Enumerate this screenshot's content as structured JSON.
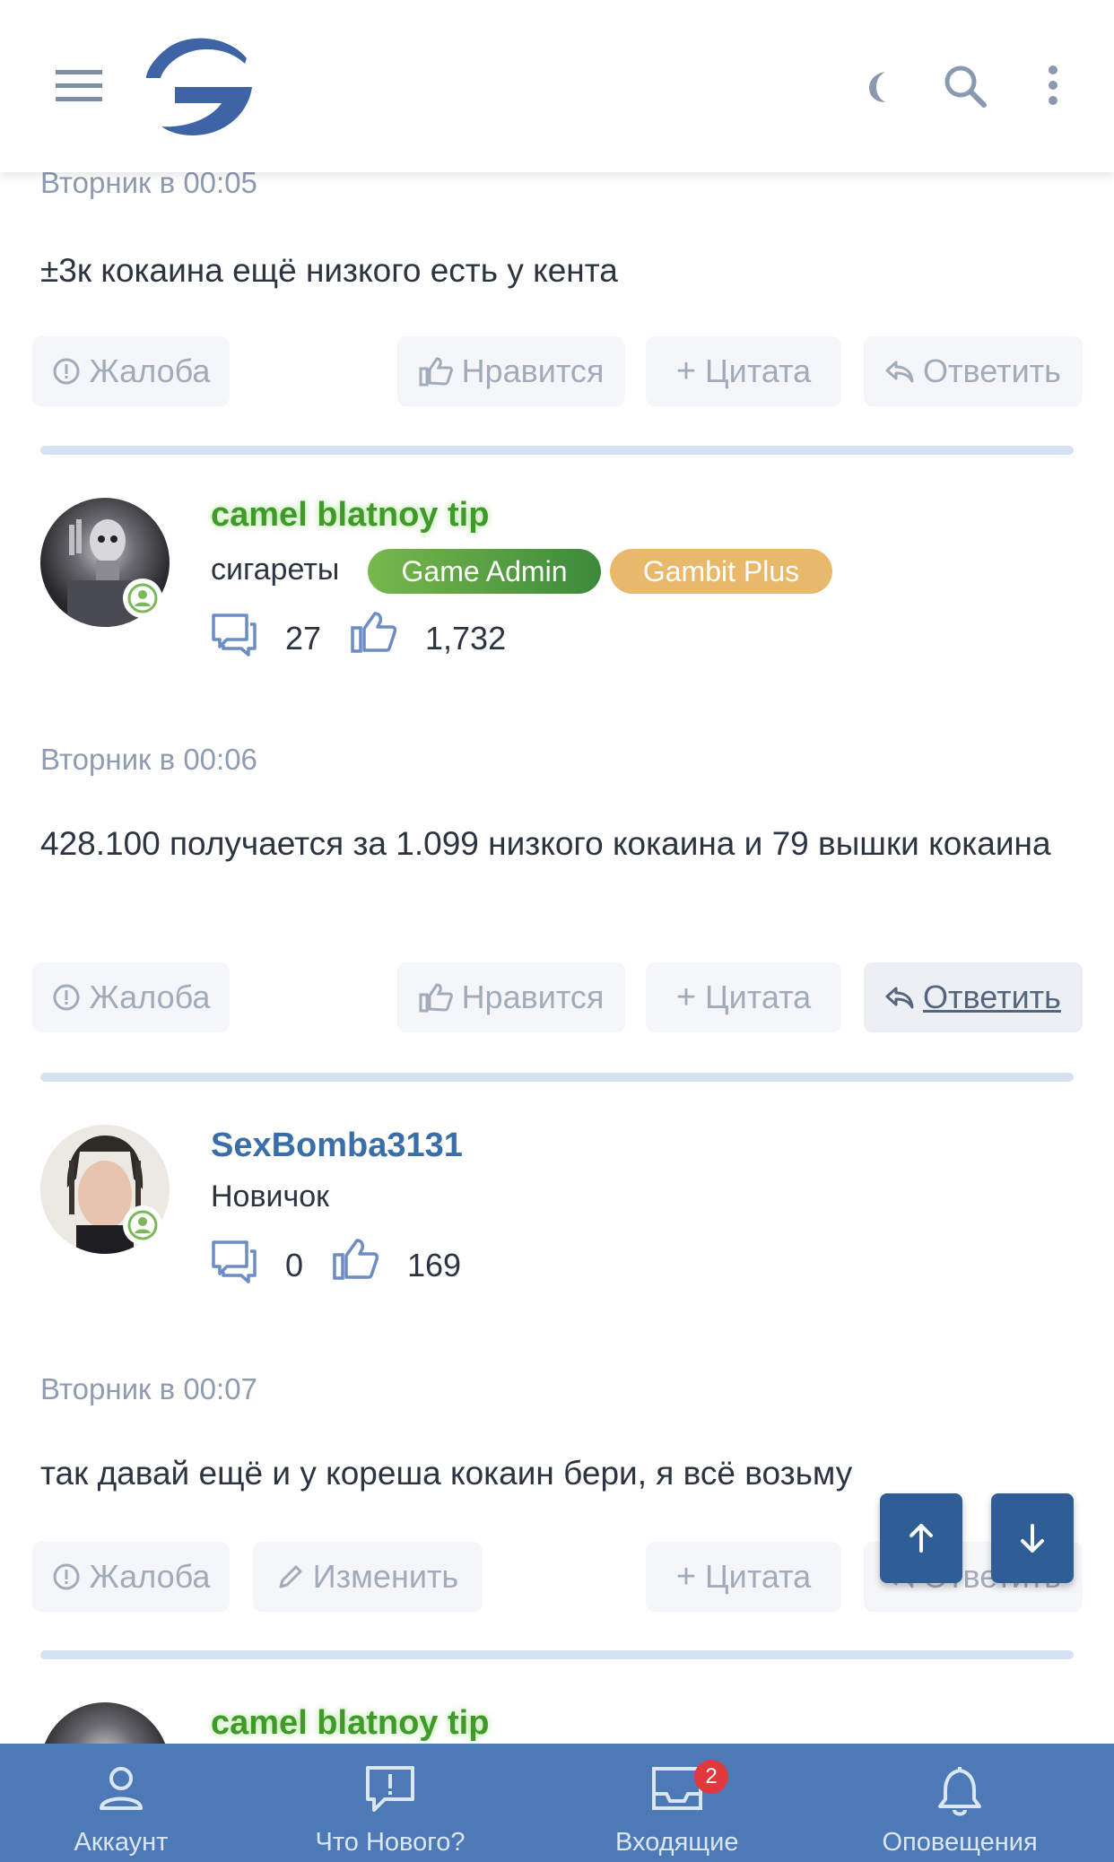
{
  "header": {
    "menu_icon": "hamburger-icon",
    "logo_icon": "site-logo",
    "theme_icon": "moon-icon",
    "search_icon": "search-icon",
    "more_icon": "more-vertical-icon"
  },
  "posts": [
    {
      "date": "Вторник в 00:05",
      "message": "±3к кокаина ещё низкого есть у кента",
      "actions": {
        "report": "Жалоба",
        "like": "Нравится",
        "quote": "Цитата",
        "reply": "Ответить"
      }
    },
    {
      "user": {
        "name": "camel blatnoy tip",
        "name_color": "#3f9a2a",
        "title": "сигареты",
        "messages": "27",
        "likes": "1,732",
        "badges": [
          {
            "label": "Game Admin",
            "color": "#5aa53e"
          },
          {
            "label": "Gambit Plus",
            "color": "#e8b86b"
          }
        ]
      },
      "date": "Вторник в 00:06",
      "message": "428.100 получается за 1.099 низкого кокаина и 79 вышки кокаина",
      "actions": {
        "report": "Жалоба",
        "like": "Нравится",
        "quote": "Цитата",
        "reply": "Ответить"
      }
    },
    {
      "user": {
        "name": "SexBomba3131",
        "name_color": "#3a6ea8",
        "title": "Новичок",
        "messages": "0",
        "likes": "169"
      },
      "date": "Вторник в 00:07",
      "message": "так давай ещё и у кореша кокаин бери, я всё возьму",
      "actions": {
        "report": "Жалоба",
        "edit": "Изменить",
        "quote": "Цитата",
        "reply": "Ответить"
      }
    },
    {
      "user": {
        "name": "camel blatnoy tip",
        "name_color": "#3f9a2a"
      }
    }
  ],
  "scroll": {
    "up_icon": "arrow-up-icon",
    "down_icon": "arrow-down-icon"
  },
  "bottom_nav": [
    {
      "label": "Аккаунт",
      "icon": "user-icon"
    },
    {
      "label": "Что Нового?",
      "icon": "whats-new-icon"
    },
    {
      "label": "Входящие",
      "icon": "inbox-icon",
      "badge": "2"
    },
    {
      "label": "Оповещения",
      "icon": "bell-icon"
    }
  ],
  "colors": {
    "accent": "#4d7ab6",
    "separator": "#d6e1f2",
    "muted": "#a2abba"
  }
}
